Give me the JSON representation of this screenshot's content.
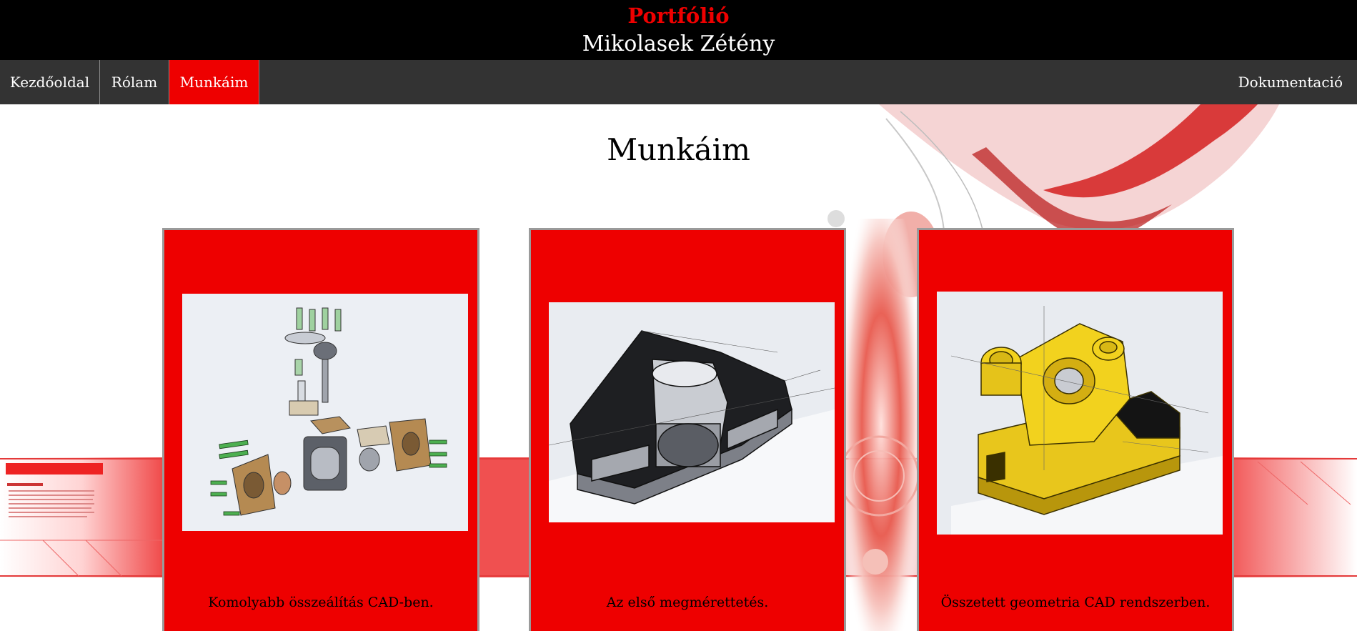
{
  "header": {
    "title": "Portfólió",
    "name": "Mikolasek Zétény"
  },
  "nav": {
    "home": "Kezdőoldal",
    "about": "Rólam",
    "works": "Munkáim",
    "docs": "Dokumentació"
  },
  "main": {
    "heading": "Munkáim"
  },
  "cards": [
    {
      "caption": "Komolyabb összeálítás CAD-ben.",
      "image": "cad-exploded-assembly"
    },
    {
      "caption": "Az első megmérettetés.",
      "image": "cad-section-housing"
    },
    {
      "caption": "Összetett geometria CAD rendszerben.",
      "image": "cad-yellow-bracket"
    }
  ],
  "colors": {
    "accent": "#ee0000",
    "header_bg": "#000000",
    "nav_bg": "#333333",
    "text_light": "#ffffff",
    "card_text": "#000000"
  }
}
